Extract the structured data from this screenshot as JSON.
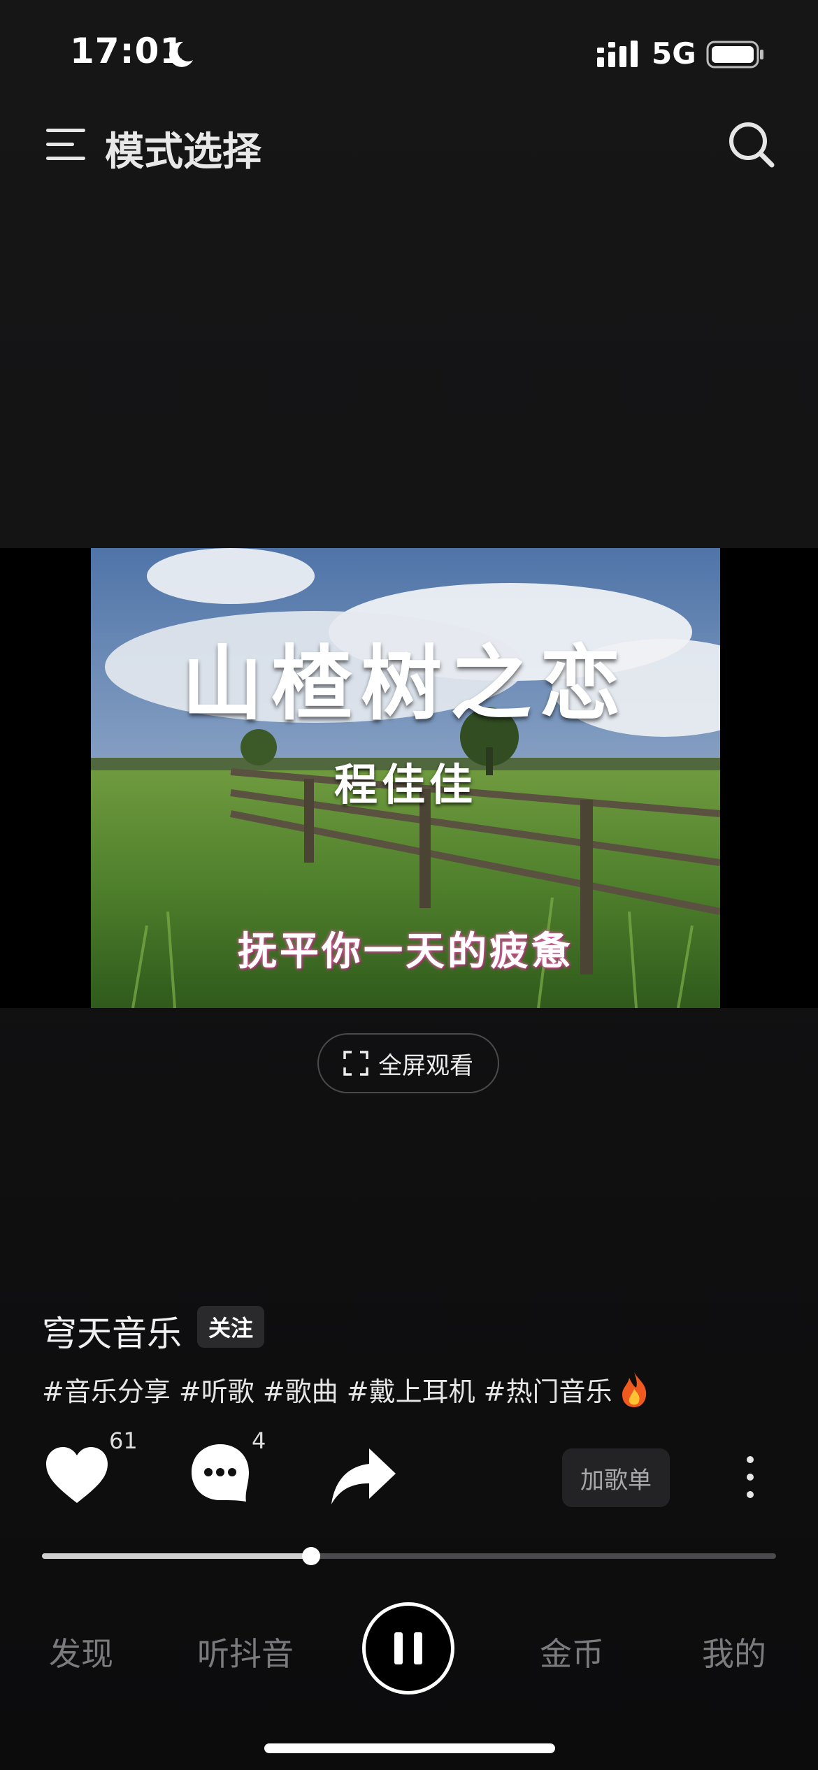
{
  "status_bar": {
    "time": "17:01",
    "network": "5G"
  },
  "header": {
    "title": "模式选择",
    "menu_icon": "menu-icon",
    "search_icon": "search-icon"
  },
  "video": {
    "title": "山楂树之恋",
    "artist": "程佳佳",
    "subtitle": "抚平你一天的疲惫"
  },
  "fullscreen": {
    "label": "全屏观看"
  },
  "post": {
    "author": "穹天音乐",
    "follow_label": "关注",
    "hashtags": "#音乐分享 #听歌 #歌曲 #戴上耳机 #热门音乐"
  },
  "actions": {
    "like_count": "61",
    "comment_count": "4",
    "playlist_label": "加歌单"
  },
  "playback": {
    "progress_fraction": 0.367
  },
  "bottom_nav": {
    "discover": "发现",
    "douyin": "听抖音",
    "coins": "金币",
    "mine": "我的"
  },
  "colors": {
    "background": "#131314",
    "accent": "#ffffff",
    "muted": "#7b7b7e"
  }
}
